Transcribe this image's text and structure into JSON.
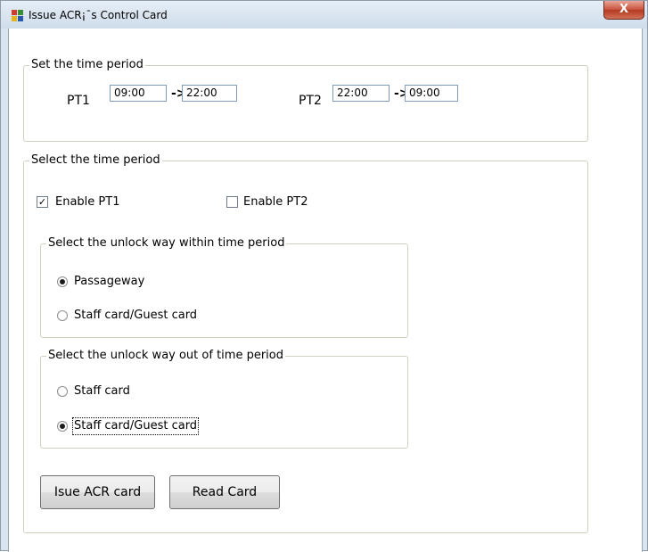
{
  "window": {
    "title": "Issue ACR¡¯s Control Card",
    "close_symbol": "X",
    "title_icon": "app-icon",
    "colors": {
      "accent_close": "#c9553f",
      "frame": "#d8e4f0"
    }
  },
  "time_period_set": {
    "label": "Set the time period",
    "pt1": {
      "label": "PT1",
      "start": "09:00",
      "arrow": "->",
      "end": "22:00"
    },
    "pt2": {
      "label": "PT2",
      "start": "22:00",
      "arrow": "->",
      "end": "09:00"
    }
  },
  "time_period_select": {
    "label": "Select the time period",
    "enable_pt1": {
      "label": "Enable PT1",
      "checked": true,
      "mark": "✓"
    },
    "enable_pt2": {
      "label": "Enable PT2",
      "checked": false
    },
    "within": {
      "label": "Select the unlock way within time period",
      "options": [
        {
          "label": "Passageway",
          "selected": true
        },
        {
          "label": "Staff card/Guest card",
          "selected": false
        }
      ]
    },
    "outside": {
      "label": "Select the unlock way out of time period",
      "options": [
        {
          "label": "Staff card",
          "selected": false
        },
        {
          "label": "Staff card/Guest card",
          "selected": true
        }
      ]
    }
  },
  "buttons": {
    "issue": "Isue ACR card",
    "read": "Read Card"
  }
}
